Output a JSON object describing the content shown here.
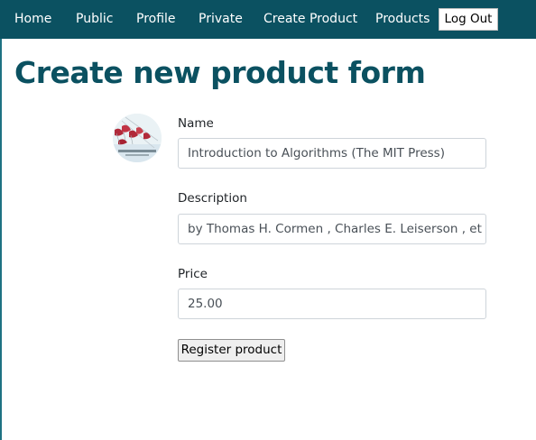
{
  "nav": {
    "items": [
      {
        "label": "Home"
      },
      {
        "label": "Public"
      },
      {
        "label": "Profile"
      },
      {
        "label": "Private"
      },
      {
        "label": "Create Product"
      },
      {
        "label": "Products"
      }
    ],
    "logout_label": "Log Out"
  },
  "page": {
    "title": "Create new product form"
  },
  "form": {
    "name_label": "Name",
    "name_value": "Introduction to Algorithms (The MIT Press)",
    "description_label": "Description",
    "description_value": "by Thomas H. Cormen , Charles E. Leiserson , et al.",
    "price_label": "Price",
    "price_value": "25.00",
    "submit_label": "Register product",
    "image_icon": "book-cover-image"
  },
  "colors": {
    "navbar": "#0b5161",
    "title": "#0b5161",
    "left_edge": "#1e7283"
  }
}
